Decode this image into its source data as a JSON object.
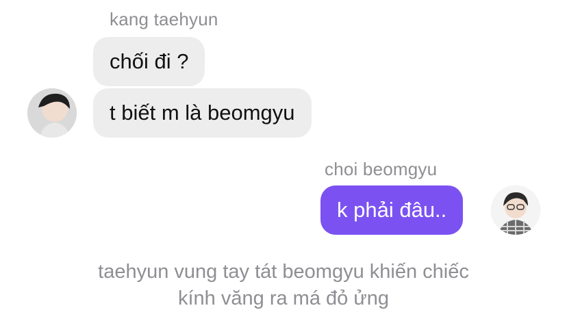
{
  "thread": {
    "incoming": {
      "sender_name": "kang taehyun",
      "avatar_icon": "profile-photo-icon",
      "messages": [
        "chối đi ?",
        "t biết m là beomgyu"
      ]
    },
    "outgoing": {
      "sender_name": "choi beomgyu",
      "avatar_icon": "profile-photo-icon",
      "messages": [
        "k phải đâu.."
      ]
    },
    "narration": {
      "line1": "taehyun vung tay tát beomgyu khiến chiếc",
      "line2": "kính văng ra má đỏ ửng"
    }
  },
  "colors": {
    "incoming_bubble": "#ededee",
    "outgoing_bubble": "#7b52f1",
    "secondary_text": "#8e8e93"
  }
}
